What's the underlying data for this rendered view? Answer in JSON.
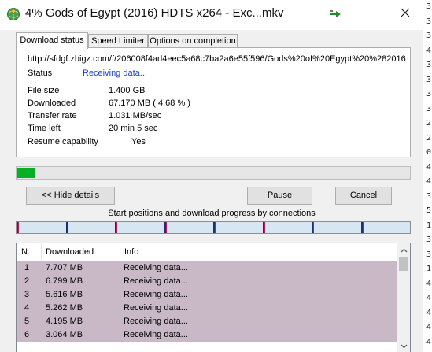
{
  "window": {
    "title": "4% Gods of Egypt (2016) HDTS x264 - Exc...mkv",
    "icons": {
      "app": "globe-download-icon",
      "pin": "arrow-pin-icon",
      "close": "close-icon"
    }
  },
  "tabs": [
    {
      "label": "Download status",
      "active": true
    },
    {
      "label": "Speed Limiter",
      "active": false
    },
    {
      "label": "Options on completion",
      "active": false
    }
  ],
  "status": {
    "url": "http://sfdgf.zbigz.com/f/206008f4ad4eec5a68c7ba2a6e55f596/Gods%20of%20Egypt%20%282016",
    "status_label": "Status",
    "status_value": "Receiving data...",
    "file_size_label": "File size",
    "file_size_value": "1.400  GB",
    "downloaded_label": "Downloaded",
    "downloaded_value": "67.170  MB  ( 4.68 % )",
    "transfer_rate_label": "Transfer rate",
    "transfer_rate_value": "1.031  MB/sec",
    "time_left_label": "Time left",
    "time_left_value": "20 min 5 sec",
    "resume_label": "Resume capability",
    "resume_value": "Yes"
  },
  "progress": {
    "fraction": 0.0468,
    "color": "#06b025"
  },
  "buttons": {
    "hide_details": "<< Hide details",
    "pause": "Pause",
    "cancel": "Cancel"
  },
  "connections": {
    "caption": "Start positions and download progress by connections",
    "count": 8
  },
  "table": {
    "columns": [
      "N.",
      "Downloaded",
      "Info"
    ],
    "rows": [
      [
        "1",
        "7.707  MB",
        "Receiving data..."
      ],
      [
        "2",
        "6.799  MB",
        "Receiving data..."
      ],
      [
        "3",
        "5.616  MB",
        "Receiving data..."
      ],
      [
        "4",
        "5.262  MB",
        "Receiving data..."
      ],
      [
        "5",
        "4.195  MB",
        "Receiving data..."
      ],
      [
        "6",
        "3.064  MB",
        "Receiving data..."
      ]
    ]
  },
  "side_digits": [
    "3",
    "3",
    "3",
    "4",
    "3",
    "3",
    "3",
    "3",
    "2",
    "2",
    "0",
    "4",
    "4",
    "3",
    "5",
    "1",
    "3",
    "3",
    "1",
    "4",
    "4",
    "4",
    "4",
    "4"
  ],
  "colors": {
    "accent_link": "#1f3fd8",
    "row_selected": "#c9b9c7",
    "conn_marker": "#1a2f7a"
  }
}
